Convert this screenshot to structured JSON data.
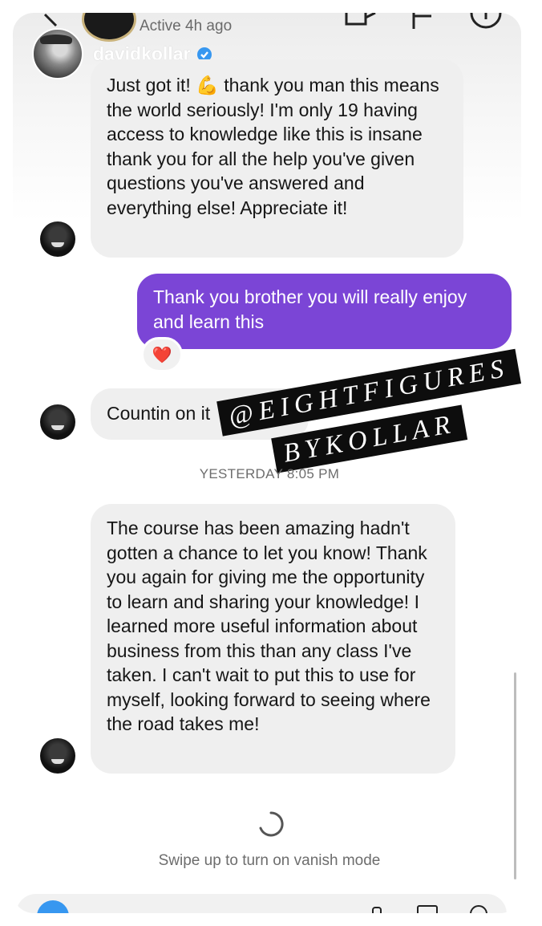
{
  "header": {
    "status": "Active 4h ago",
    "username": "davidkollar",
    "verified_icon": "verified-badge-icon",
    "icons": [
      "back-chevron-icon",
      "video-call-icon",
      "flag-icon",
      "info-icon"
    ]
  },
  "messages": [
    {
      "direction": "incoming",
      "text": "Just got it! 💪 thank you man this means the world seriously! I'm only 19 having access to knowledge like this is insane thank you for all the help you've given questions you've answered and everything else! Appreciate it!"
    },
    {
      "direction": "outgoing",
      "text": "Thank you brother you will really enjoy and learn this",
      "reaction": "❤️"
    },
    {
      "direction": "incoming",
      "text": "Countin on it"
    },
    {
      "direction": "incoming",
      "text": "The course has been amazing hadn't gotten a chance to let you know! Thank you again for giving me the opportunity to learn and sharing your knowledge! I learned more useful information about business from this than any class I've taken. I can't wait to put this to use for myself, looking forward to seeing where the road takes me!"
    }
  ],
  "timestamp": "YESTERDAY 8:05 PM",
  "sticker": {
    "line1": "@EIGHTFIGURES",
    "line2": "BYKOLLAR"
  },
  "footer": {
    "vanish_hint": "Swipe up to turn on vanish mode"
  },
  "colors": {
    "outgoing_bubble": "#7b45d6",
    "incoming_bubble": "#efefef",
    "verified": "#3797f0"
  }
}
